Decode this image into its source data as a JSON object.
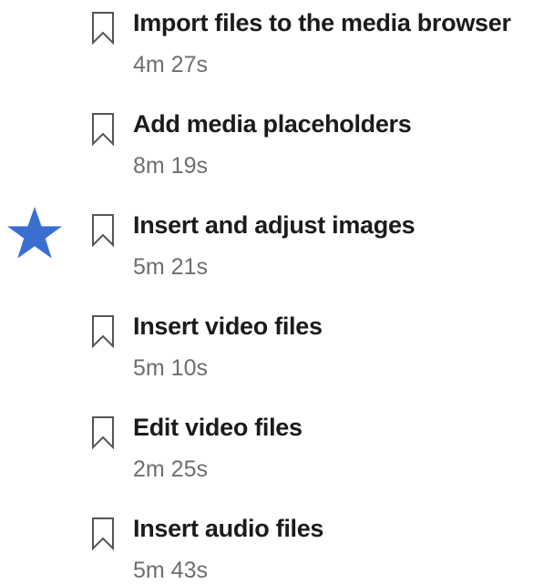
{
  "lessons": [
    {
      "title": "Import files to the media browser",
      "duration": "4m 27s",
      "icon": "bookmark-icon"
    },
    {
      "title": "Add media placeholders",
      "duration": "8m 19s",
      "icon": "bookmark-icon"
    },
    {
      "title": "Insert and adjust images",
      "duration": "5m 21s",
      "icon": "bookmark-icon"
    },
    {
      "title": "Insert video files",
      "duration": "5m 10s",
      "icon": "bookmark-icon"
    },
    {
      "title": "Edit video files",
      "duration": "2m 25s",
      "icon": "bookmark-icon"
    },
    {
      "title": "Insert audio files",
      "duration": "5m 43s",
      "icon": "bookmark-icon"
    }
  ],
  "marker": {
    "icon": "star-icon",
    "color": "#3a6fd1"
  },
  "colors": {
    "title": "#1b1b1b",
    "duration": "#6e6e6e",
    "bookmark": "#555555"
  }
}
